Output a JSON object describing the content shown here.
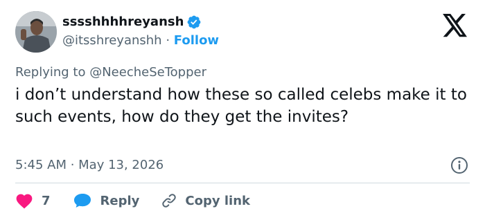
{
  "author": {
    "display_name": "sssshhhhreyansh",
    "handle": "@itsshreyanshh",
    "separator": "·",
    "follow_label": "Follow",
    "verified": true
  },
  "reply_context": {
    "prefix": "Replying to",
    "mention": "@NeecheSeTopper"
  },
  "tweet": {
    "text": "i don’t understand how these so called celebs make it to such events, how do they get the invites?",
    "timestamp": "5:45 AM · May 13, 2026"
  },
  "actions": {
    "like_count": "7",
    "reply_label": "Reply",
    "copy_link_label": "Copy link"
  },
  "icons": {
    "logo": "x-logo-icon",
    "verified": "verified-badge-icon",
    "info": "info-icon",
    "like": "heart-icon",
    "reply": "speech-bubble-icon",
    "copy_link": "link-icon"
  },
  "colors": {
    "accent": "#1d9bf0",
    "like": "#f91880",
    "text_primary": "#0f1419",
    "text_secondary": "#536471",
    "divider": "#cfd9de"
  }
}
